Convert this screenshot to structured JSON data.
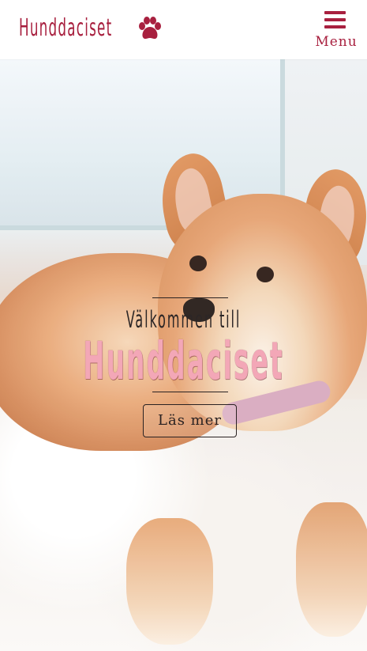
{
  "header": {
    "logo_text": "Hunddaciset",
    "logo_icon": "paw-icon",
    "menu_label": "Menu",
    "menu_icon": "hamburger-icon"
  },
  "hero": {
    "welcome_text": "Välkommen till",
    "title": "Hunddaciset",
    "cta_label": "Läs mer",
    "image": "shiba-inu-puppy-photo"
  },
  "colors": {
    "brand": "#a8203f",
    "title_pink": "#f3a7b7",
    "dark_text": "#2a2222"
  }
}
